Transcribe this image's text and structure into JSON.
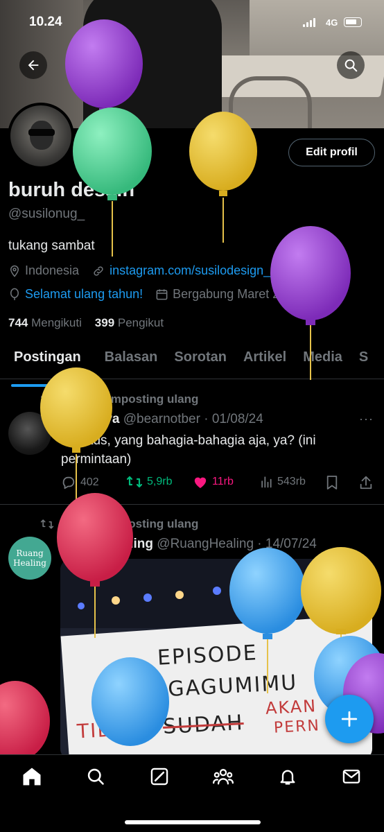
{
  "status_bar": {
    "time": "10.24",
    "network": "4G"
  },
  "header": {
    "edit_label": "Edit profil"
  },
  "profile": {
    "name": "buruh desain",
    "handle": "@susilonug_",
    "bio": "tukang sambat",
    "location": "Indonesia",
    "website": "instagram.com/susilodesign_/...",
    "birthday_text": "Selamat ulang tahun!",
    "joined": "Bergabung Maret 2018",
    "following_count": "744",
    "following_label": "Mengikuti",
    "followers_count": "399",
    "followers_label": "Pengikut"
  },
  "tabs": [
    {
      "label": "Postingan"
    },
    {
      "label": "Balasan"
    },
    {
      "label": "Sorotan"
    },
    {
      "label": "Artikel"
    },
    {
      "label": "Media"
    },
    {
      "label": "S"
    }
  ],
  "posts": [
    {
      "repost_label": "Anda memposting ulang",
      "author": "bernadya",
      "handle_date": "@bearnotber · 01/08/24",
      "text": "agustus, yang bahagia-bahagia aja, ya? (ini permintaan)",
      "replies": "402",
      "reposts": "5,9rb",
      "likes": "11rb",
      "views": "543rb"
    },
    {
      "repost_label": "Anda memposting ulang",
      "author": "Ruang Healing",
      "handle_date": "@RuangHealing · 14/07/24",
      "avatar_text_1": "Ruang",
      "avatar_text_2": "Healing",
      "media_text": {
        "line1": "EPISODE",
        "line2": "MENGAGUMIMU",
        "line3_strike": "SUDAH",
        "line3_prefix": "TIDAK",
        "line3_right": "AKAN",
        "line4_right": "PERN"
      }
    }
  ],
  "colors": {
    "accent": "#1d9bf0",
    "repost_green": "#00ba7c",
    "like_pink": "#f91880",
    "muted": "#71767b"
  }
}
